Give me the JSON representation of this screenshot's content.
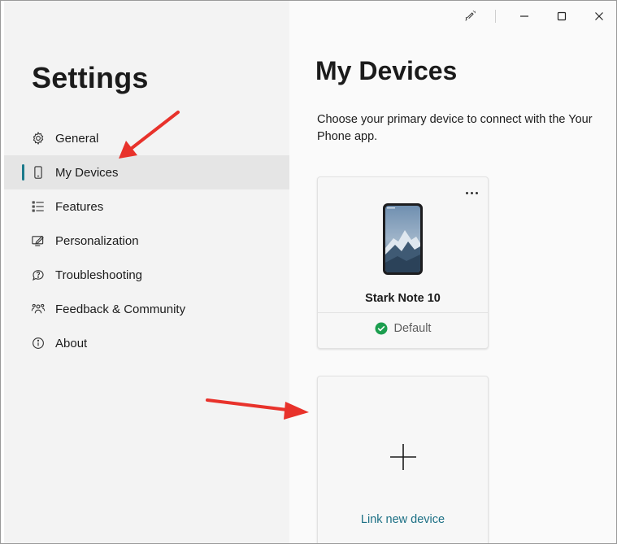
{
  "window": {
    "controls": {
      "pen_icon": "paint-brush-icon",
      "minimize_icon": "minimize-icon",
      "maximize_icon": "maximize-icon",
      "close_icon": "close-icon"
    }
  },
  "sidebar": {
    "title": "Settings",
    "items": [
      {
        "label": "General",
        "icon": "gear-icon",
        "active": false
      },
      {
        "label": "My Devices",
        "icon": "phone-icon",
        "active": true
      },
      {
        "label": "Features",
        "icon": "list-icon",
        "active": false
      },
      {
        "label": "Personalization",
        "icon": "personalize-icon",
        "active": false
      },
      {
        "label": "Troubleshooting",
        "icon": "troubleshoot-icon",
        "active": false
      },
      {
        "label": "Feedback & Community",
        "icon": "people-icon",
        "active": false
      },
      {
        "label": "About",
        "icon": "info-icon",
        "active": false
      }
    ]
  },
  "main": {
    "title": "My Devices",
    "description": "Choose your primary device to connect with the Your Phone app.",
    "device_card": {
      "name": "Stark Note 10",
      "status": "Default",
      "more_icon": "more-options-icon"
    },
    "link_card": {
      "label": "Link new device",
      "icon": "plus-icon"
    }
  },
  "colors": {
    "accent": "#1b7a8b",
    "link": "#1b6f84",
    "success": "#1c9e4f",
    "annotation_arrow": "#e8322b",
    "sidebar_bg": "#f3f3f3",
    "selected_bg": "#e5e5e5"
  }
}
